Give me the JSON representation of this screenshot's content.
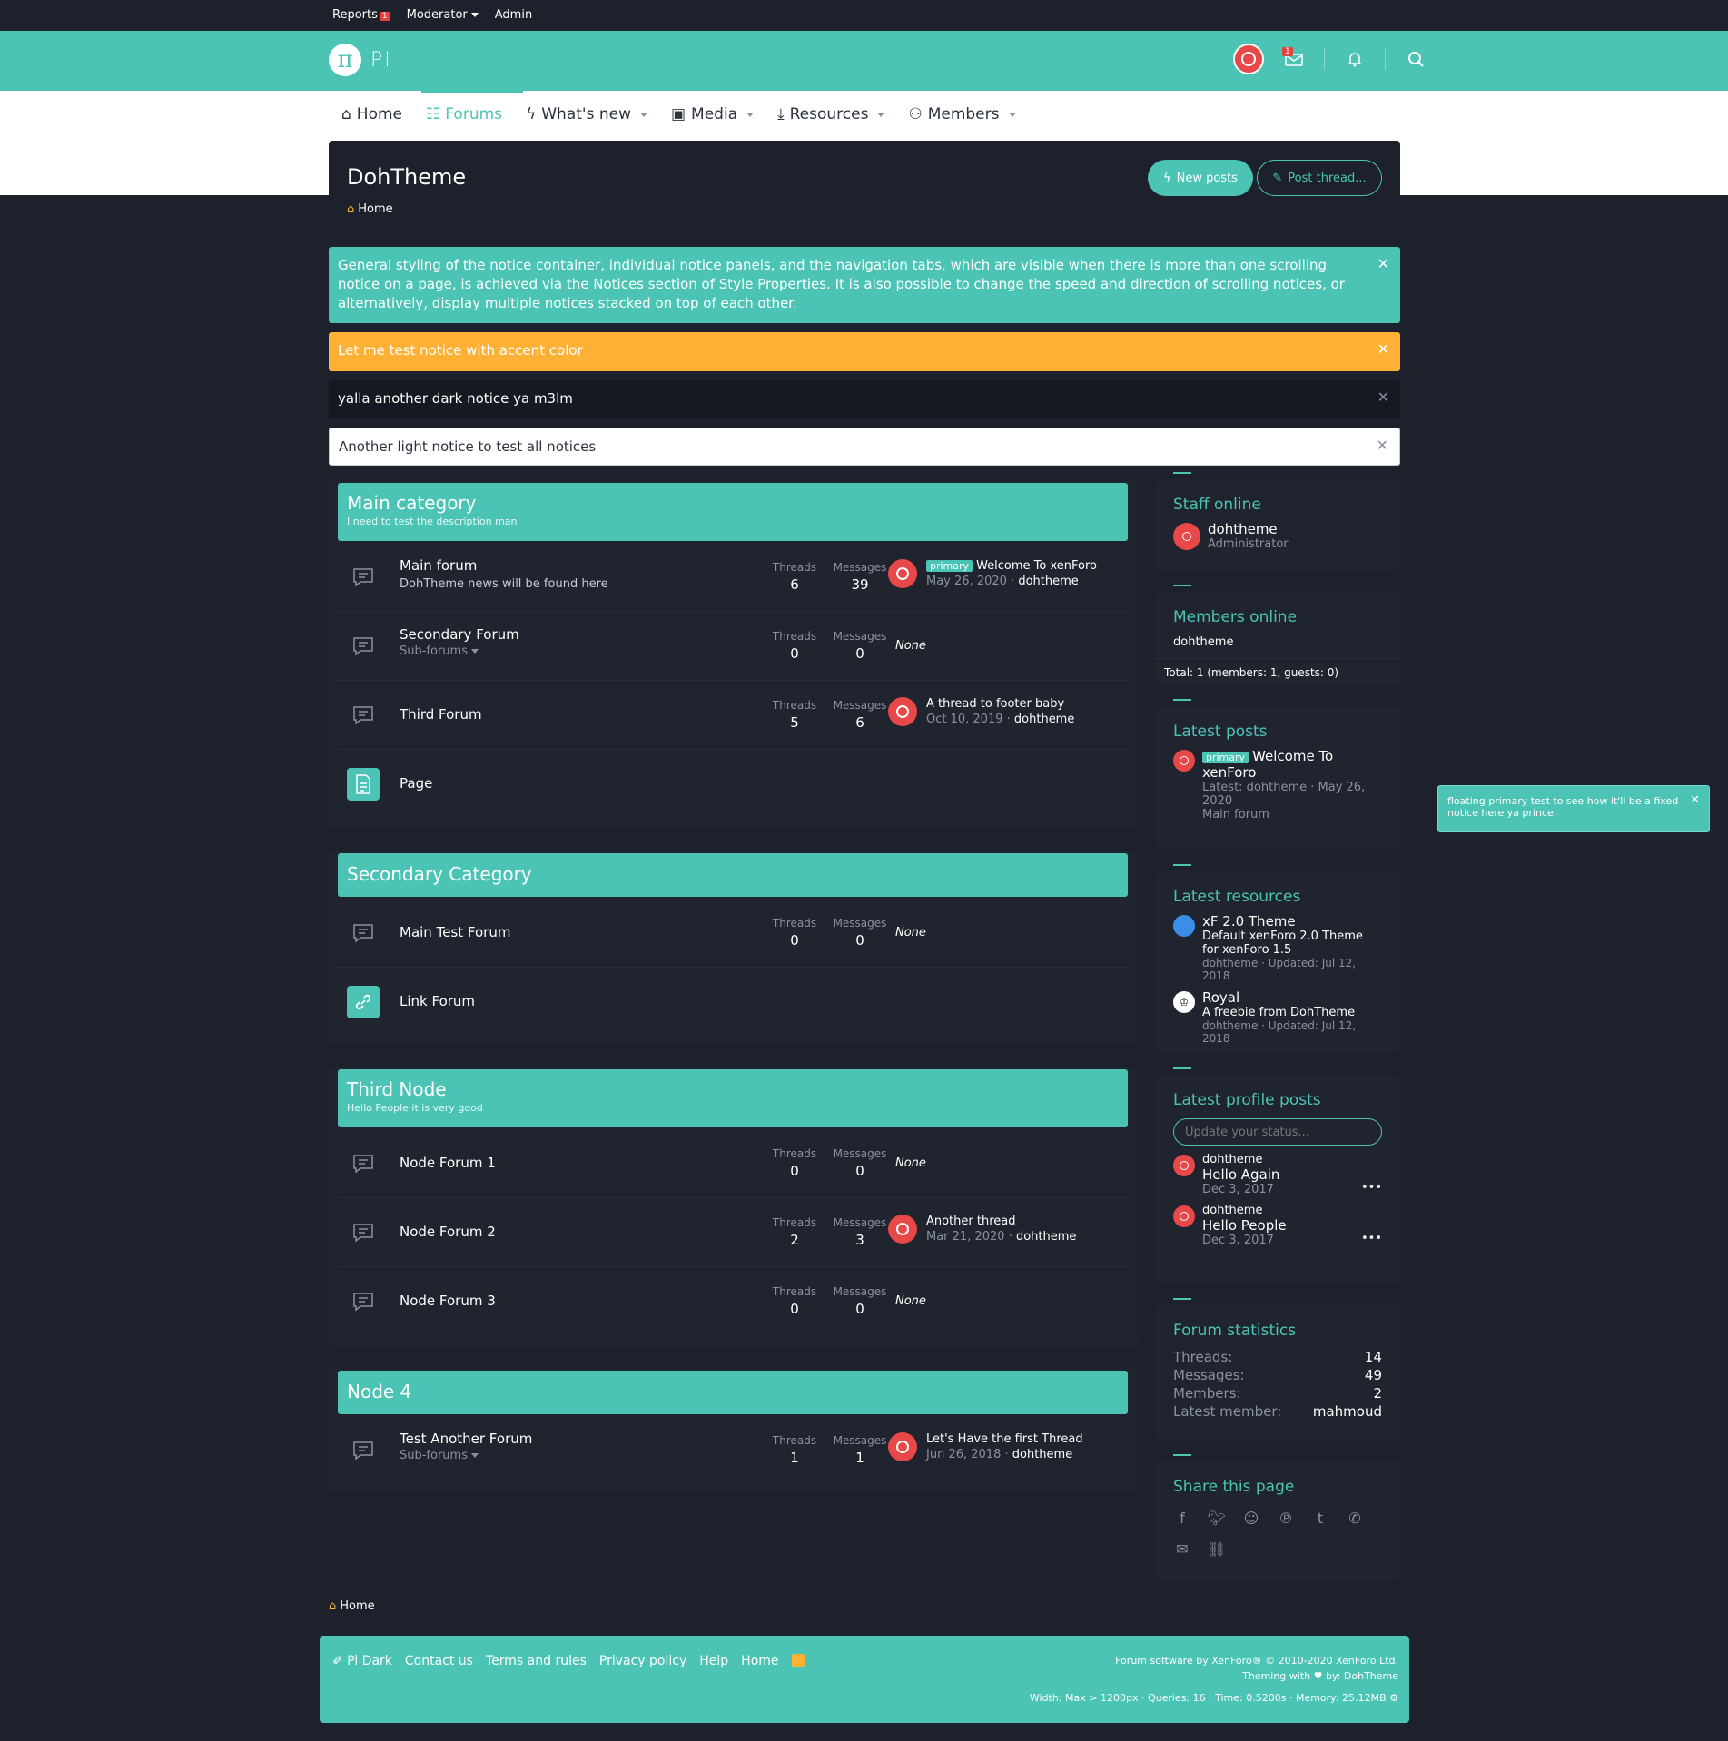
{
  "staffbar": {
    "reports": "Reports",
    "reports_count": "1",
    "moderator": "Moderator",
    "admin": "Admin"
  },
  "header": {
    "logo_glyph": "π",
    "logo_text": "PI",
    "inbox_count": "1"
  },
  "nav": {
    "home": "Home",
    "forums": "Forums",
    "whats_new": "What's new",
    "media": "Media",
    "resources": "Resources",
    "members": "Members"
  },
  "page": {
    "title": "DohTheme",
    "breadcrumb": "Home",
    "new_posts": "New posts",
    "post_thread": "Post thread..."
  },
  "notices": [
    {
      "text": "General styling of the notice container, individual notice panels, and the navigation tabs, which are visible when there is more than one scrolling notice on a page, is achieved via the Notices section of Style Properties. It is also possible to change the speed and direction of scrolling notices, or alternatively, display multiple notices stacked on top of each other."
    },
    {
      "text": "Let me test notice with accent color"
    },
    {
      "text": "yalla another dark notice ya m3lm"
    },
    {
      "text": "Another light notice to test all notices"
    }
  ],
  "labels": {
    "threads": "Threads",
    "messages": "Messages",
    "none": "None",
    "subforums": "Sub-forums",
    "primary": "primary"
  },
  "categories": [
    {
      "title": "Main category",
      "desc": "I need to test the description man",
      "forums": [
        {
          "title": "Main forum",
          "desc": "DohTheme news will be found here",
          "threads": "6",
          "messages": "39",
          "last_title": "Welcome To xenForo",
          "last_date": "May 26, 2020",
          "last_user": "dohtheme"
        },
        {
          "title": "Secondary Forum",
          "threads": "0",
          "messages": "0"
        },
        {
          "title": "Third Forum",
          "threads": "5",
          "messages": "6",
          "last_title": "A thread to footer baby",
          "last_date": "Oct 10, 2019",
          "last_user": "dohtheme"
        },
        {
          "title": "Page"
        }
      ]
    },
    {
      "title": "Secondary Category",
      "forums": [
        {
          "title": "Main Test Forum",
          "threads": "0",
          "messages": "0"
        },
        {
          "title": "Link Forum"
        }
      ]
    },
    {
      "title": "Third Node",
      "desc": "Hello People it is very good",
      "forums": [
        {
          "title": "Node Forum 1",
          "threads": "0",
          "messages": "0"
        },
        {
          "title": "Node Forum 2",
          "threads": "2",
          "messages": "3",
          "last_title": "Another thread",
          "last_date": "Mar 21, 2020",
          "last_user": "dohtheme"
        },
        {
          "title": "Node Forum 3",
          "threads": "0",
          "messages": "0"
        }
      ]
    },
    {
      "title": "Node 4",
      "forums": [
        {
          "title": "Test Another Forum",
          "threads": "1",
          "messages": "1",
          "last_title": "Let's Have the first Thread",
          "last_date": "Jun 26, 2018",
          "last_user": "dohtheme"
        }
      ]
    }
  ],
  "sidebar": {
    "staff": {
      "title": "Staff online",
      "name": "dohtheme",
      "role": "Administrator"
    },
    "members": {
      "title": "Members online",
      "name": "dohtheme",
      "total": "Total: 1 (members: 1, guests: 0)"
    },
    "latest_posts": {
      "title": "Latest posts",
      "post_title": "Welcome To xenForo",
      "meta": "Latest: dohtheme · May 26, 2020",
      "forum": "Main forum"
    },
    "latest_resources": {
      "title": "Latest resources",
      "items": [
        {
          "title": "xF 2.0 Theme",
          "desc": "Default xenForo 2.0 Theme for xenForo 1.5",
          "meta": "dohtheme · Updated: Jul 12, 2018"
        },
        {
          "title": "Royal",
          "desc": "A freebie from DohTheme",
          "meta": "dohtheme · Updated: Jul 12, 2018"
        }
      ]
    },
    "profile_posts": {
      "title": "Latest profile posts",
      "placeholder": "Update your status...",
      "items": [
        {
          "user": "dohtheme",
          "text": "Hello Again",
          "date": "Dec 3, 2017"
        },
        {
          "user": "dohtheme",
          "text": "Hello People",
          "date": "Dec 3, 2017"
        }
      ]
    },
    "stats": {
      "title": "Forum statistics",
      "threads_k": "Threads:",
      "threads_v": "14",
      "messages_k": "Messages:",
      "messages_v": "49",
      "members_k": "Members:",
      "members_v": "2",
      "latest_k": "Latest member:",
      "latest_v": "mahmoud"
    },
    "share": {
      "title": "Share this page"
    }
  },
  "floating_notice": "floating primary test to see how it'll be a fixed notice here ya prince",
  "footer": {
    "style": "Pi Dark",
    "links": [
      "Contact us",
      "Terms and rules",
      "Privacy policy",
      "Help",
      "Home"
    ],
    "copyright": "Forum software by XenForo® © 2010-2020 XenForo Ltd.",
    "theming": "Theming with ♥ by: DohTheme",
    "meta": "Width: Max > 1200px · Queries: 16 · Time: 0.5200s · Memory: 25.12MB"
  },
  "colors": {
    "accent": "#4bc4b5",
    "orange": "#ffb136",
    "bg": "#1c212b",
    "panel": "#1f242e"
  }
}
